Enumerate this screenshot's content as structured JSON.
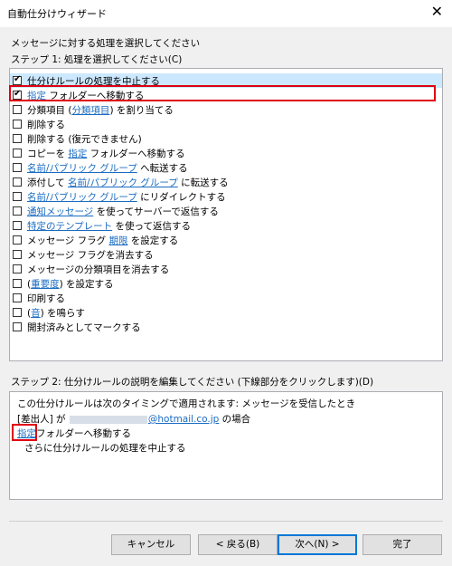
{
  "window": {
    "title": "自動仕分けウィザード",
    "close_glyph": "✕"
  },
  "header": {
    "instruction": "メッセージに対する処理を選択してください",
    "step1_label": "ステップ 1: 処理を選択してください(C)"
  },
  "actions": [
    {
      "checked": true,
      "selected": true,
      "segments": [
        {
          "t": "仕分けルールの処理を中止する",
          "link": false
        }
      ]
    },
    {
      "checked": true,
      "selected": false,
      "segments": [
        {
          "t": "指定",
          "link": true
        },
        {
          "t": " フォルダーへ移動する",
          "link": false
        }
      ]
    },
    {
      "checked": false,
      "selected": false,
      "segments": [
        {
          "t": "分類項目 (",
          "link": false
        },
        {
          "t": "分類項目",
          "link": true
        },
        {
          "t": ") を割り当てる",
          "link": false
        }
      ]
    },
    {
      "checked": false,
      "selected": false,
      "segments": [
        {
          "t": "削除する",
          "link": false
        }
      ]
    },
    {
      "checked": false,
      "selected": false,
      "segments": [
        {
          "t": "削除する (復元できません)",
          "link": false
        }
      ]
    },
    {
      "checked": false,
      "selected": false,
      "segments": [
        {
          "t": "コピーを ",
          "link": false
        },
        {
          "t": "指定",
          "link": true
        },
        {
          "t": " フォルダーへ移動する",
          "link": false
        }
      ]
    },
    {
      "checked": false,
      "selected": false,
      "segments": [
        {
          "t": "名前/パブリック グループ",
          "link": true
        },
        {
          "t": " へ転送する",
          "link": false
        }
      ]
    },
    {
      "checked": false,
      "selected": false,
      "segments": [
        {
          "t": "添付して ",
          "link": false
        },
        {
          "t": "名前/パブリック グループ",
          "link": true
        },
        {
          "t": " に転送する",
          "link": false
        }
      ]
    },
    {
      "checked": false,
      "selected": false,
      "segments": [
        {
          "t": "名前/パブリック グループ",
          "link": true
        },
        {
          "t": " にリダイレクトする",
          "link": false
        }
      ]
    },
    {
      "checked": false,
      "selected": false,
      "segments": [
        {
          "t": "通知メッセージ",
          "link": true
        },
        {
          "t": " を使ってサーバーで返信する",
          "link": false
        }
      ]
    },
    {
      "checked": false,
      "selected": false,
      "segments": [
        {
          "t": "特定のテンプレート",
          "link": true
        },
        {
          "t": " を使って返信する",
          "link": false
        }
      ]
    },
    {
      "checked": false,
      "selected": false,
      "segments": [
        {
          "t": "メッセージ フラグ ",
          "link": false
        },
        {
          "t": "期限",
          "link": true
        },
        {
          "t": " を設定する",
          "link": false
        }
      ]
    },
    {
      "checked": false,
      "selected": false,
      "segments": [
        {
          "t": "メッセージ フラグを消去する",
          "link": false
        }
      ]
    },
    {
      "checked": false,
      "selected": false,
      "segments": [
        {
          "t": "メッセージの分類項目を消去する",
          "link": false
        }
      ]
    },
    {
      "checked": false,
      "selected": false,
      "segments": [
        {
          "t": "(",
          "link": false
        },
        {
          "t": "重要度",
          "link": true
        },
        {
          "t": ") を設定する",
          "link": false
        }
      ]
    },
    {
      "checked": false,
      "selected": false,
      "segments": [
        {
          "t": "印刷する",
          "link": false
        }
      ]
    },
    {
      "checked": false,
      "selected": false,
      "segments": [
        {
          "t": "(",
          "link": false
        },
        {
          "t": "音",
          "link": true
        },
        {
          "t": ") を鳴らす",
          "link": false
        }
      ]
    },
    {
      "checked": false,
      "selected": false,
      "segments": [
        {
          "t": "開封済みとしてマークする",
          "link": false
        }
      ]
    }
  ],
  "step2": {
    "label": "ステップ 2: 仕分けルールの説明を編集してください (下線部分をクリックします)(D)",
    "line1": "この仕分けルールは次のタイミングで適用されます: メッセージを受信したとき",
    "line2_prefix": "[差出人] が ",
    "line2_email": "@hotmail.co.jp",
    "line2_suffix": " の場合",
    "line3_link": "指定",
    "line3_rest": "フォルダーへ移動する",
    "line4": "さらに仕分けルールの処理を中止する"
  },
  "buttons": {
    "cancel": "キャンセル",
    "back": "< 戻る(B)",
    "next": "次へ(N) >",
    "finish": "完了"
  },
  "colors": {
    "link": "#1a6cc2",
    "selection": "#cce8ff",
    "highlight_box": "#e00012",
    "default_button_border": "#0078d7"
  }
}
